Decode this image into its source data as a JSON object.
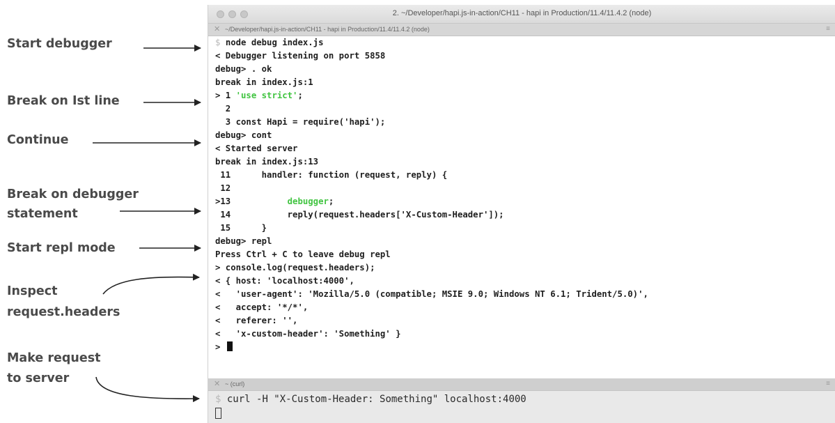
{
  "annotations": {
    "start_debugger": "Start debugger",
    "break_first_line": "Break on Ist line",
    "continue": "Continue",
    "break_statement_1": "Break on debugger",
    "break_statement_2": "statement",
    "start_repl": "Start repl mode",
    "inspect_1": "Inspect",
    "inspect_2": "request.headers",
    "make_request_1": "Make request",
    "make_request_2": "to server"
  },
  "window": {
    "title": "2. ~/Developer/hapi.js-in-action/CH11 - hapi in Production/11.4/11.4.2 (node)",
    "top_tab_path": "~/Developer/hapi.js-in-action/CH11 - hapi in Production/11.4/11.4.2 (node)",
    "bottom_tab_label": "~ (curl)",
    "tab_close": "✕",
    "tab_menu": "≡"
  },
  "terminal": {
    "prompt_symbol": "$",
    "command": "node debug index.js",
    "lines": [
      "< Debugger listening on port 5858",
      "debug> . ok",
      "break in index.js:1",
      "> 1 ",
      "  2",
      "  3 const Hapi = require('hapi');",
      "debug> cont",
      "< Started server",
      "break in index.js:13",
      " 11      handler: function (request, reply) {",
      " 12",
      ">13           ",
      " 14           reply(request.headers['X-Custom-Header']);",
      " 15      }",
      "debug> repl",
      "Press Ctrl + C to leave debug repl",
      "> console.log(request.headers);",
      "< { host: 'localhost:4000',",
      "<   'user-agent': 'Mozilla/5.0 (compatible; MSIE 9.0; Windows NT 6.1; Trident/5.0)',",
      "<   accept: '*/*',",
      "<   referer: '',",
      "<   'x-custom-header': 'Something' }",
      "> "
    ],
    "use_strict_string": "'use strict'",
    "use_strict_rest": ";",
    "debugger_keyword": "debugger",
    "debugger_rest": ";"
  },
  "bottom_terminal": {
    "prompt_symbol": "$",
    "command": "curl -H \"X-Custom-Header: Something\" localhost:4000"
  },
  "colors": {
    "string_green": "#41c441",
    "annotation_text": "#4a4a4a"
  }
}
